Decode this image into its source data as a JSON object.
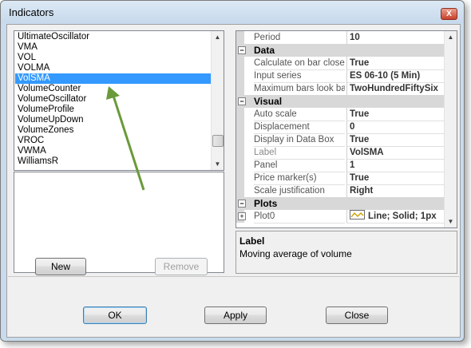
{
  "window": {
    "title": "Indicators",
    "close_glyph": "X"
  },
  "indicator_list": {
    "items": [
      "UltimateOscillator",
      "VMA",
      "VOL",
      "VOLMA",
      "VolSMA",
      "VolumeCounter",
      "VolumeOscillator",
      "VolumeProfile",
      "VolumeUpDown",
      "VolumeZones",
      "VROC",
      "VWMA",
      "WilliamsR"
    ],
    "selected": "VolSMA"
  },
  "buttons": {
    "new": "New",
    "remove": "Remove",
    "ok": "OK",
    "apply": "Apply",
    "close": "Close"
  },
  "properties": {
    "period": {
      "name": "Period",
      "value": "10"
    },
    "data": {
      "header": "Data",
      "calc_on_bar_close": {
        "name": "Calculate on bar close",
        "value": "True"
      },
      "input_series": {
        "name": "Input series",
        "value": "ES 06-10 (5 Min)"
      },
      "max_bars": {
        "name": "Maximum bars look back",
        "value": "TwoHundredFiftySix"
      }
    },
    "visual": {
      "header": "Visual",
      "auto_scale": {
        "name": "Auto scale",
        "value": "True"
      },
      "displacement": {
        "name": "Displacement",
        "value": "0"
      },
      "display_in_data_box": {
        "name": "Display in Data Box",
        "value": "True"
      },
      "label": {
        "name": "Label",
        "value": "VolSMA"
      },
      "panel": {
        "name": "Panel",
        "value": "1"
      },
      "price_markers": {
        "name": "Price marker(s)",
        "value": "True"
      },
      "scale_justification": {
        "name": "Scale justification",
        "value": "Right"
      }
    },
    "plots": {
      "header": "Plots",
      "plot0": {
        "name": "Plot0",
        "value": "Line; Solid; 1px"
      }
    }
  },
  "description": {
    "title": "Label",
    "text": "Moving average of volume"
  },
  "colors": {
    "selection": "#3399ff",
    "annotation_arrow": "#6a9a3a",
    "plot_line": "#c8a000"
  },
  "expanders": {
    "collapsed": "−",
    "plot_expand": "+"
  },
  "scroll_glyphs": {
    "up": "▲",
    "down": "▼"
  }
}
